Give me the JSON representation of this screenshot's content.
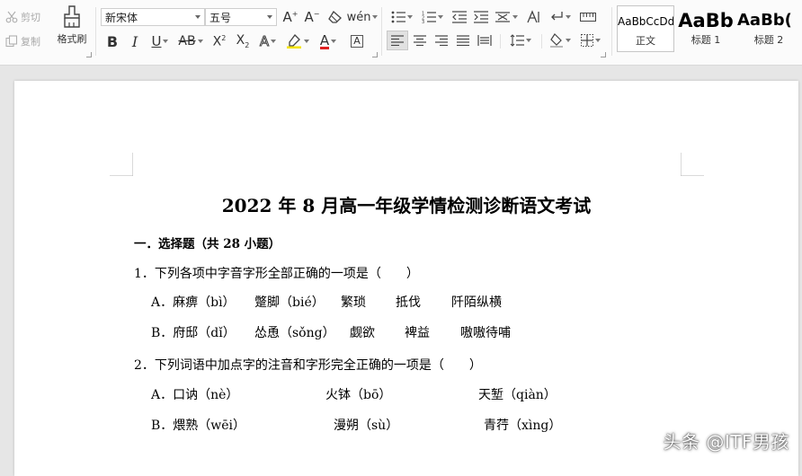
{
  "ribbon": {
    "clipboard": {
      "cut": "剪切",
      "copy": "复制",
      "format_painter": "格式刷"
    },
    "font": {
      "family": "新宋体",
      "size": "五号"
    },
    "styles": [
      {
        "preview": "AaBbCcDd",
        "label": "正文"
      },
      {
        "preview": "AaBb",
        "label": "标题 1"
      },
      {
        "preview": "AaBb(",
        "label": "标题 2"
      }
    ]
  },
  "document": {
    "title": "2022 年 8 月高一年级学情检测诊断语文考试",
    "section": "一．选择题（共 28 小题）",
    "questions": [
      {
        "stem": "1．下列各项中字音字形全部正确的一项是（　　）",
        "options": [
          {
            "items": [
              "A．麻痹（bì）",
              "蹩脚（bié）",
              "繁琐",
              "抵伐",
              "阡陌纵横"
            ]
          },
          {
            "items": [
              "B．府邸（dǐ）",
              "怂恿（sǒng）",
              "觑欲",
              "裨益",
              "嗷嗷待哺"
            ]
          }
        ]
      },
      {
        "stem": "2．下列词语中加点字的注音和字形完全正确的一项是（　　）",
        "options": [
          {
            "items": [
              "A．口讷（nè）",
              "火钵（bō）",
              "天堑（qiàn）"
            ]
          },
          {
            "items": [
              "B．煨熟（wēi）",
              "漫朔（sù）",
              "青荇（xìng）"
            ]
          }
        ]
      }
    ]
  },
  "watermark": "头条 @ITF男孩"
}
